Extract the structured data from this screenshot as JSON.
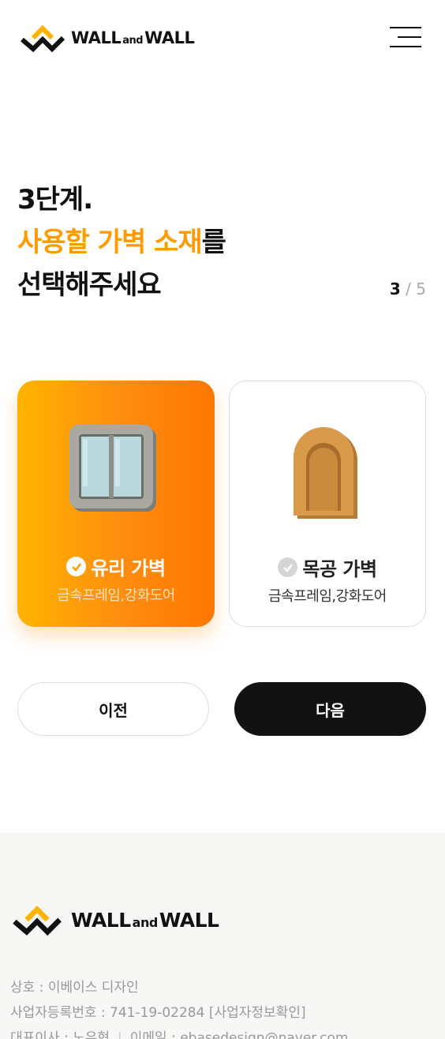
{
  "header": {
    "logo_text_left": "WALL",
    "logo_text_mid": "and",
    "logo_text_right": "WALL",
    "menu_icon": "hamburger-menu-icon"
  },
  "step": {
    "heading": "3단계.",
    "highlight": "사용할 가벽 소재",
    "heading_suffix": "를",
    "heading_line3": "선택해주세요",
    "current": "3",
    "separator": "/",
    "total": "5"
  },
  "options": [
    {
      "title": "유리 가벽",
      "subtitle": "금속프레임,강화도어",
      "selected": true,
      "icon": "glass-window-icon"
    },
    {
      "title": "목공 가벽",
      "subtitle": "금속프레임,강화도어",
      "selected": false,
      "icon": "wooden-arch-icon"
    }
  ],
  "nav": {
    "prev_label": "이전",
    "next_label": "다음"
  },
  "footer": {
    "logo_text_left": "WALL",
    "logo_text_mid": "and",
    "logo_text_right": "WALL",
    "company": "상호 : 이베이스 디자인",
    "business_no": "사업자등록번호 : 741-19-02284 [사업자정보확인]",
    "ceo": "대표이사 : 노유현",
    "email": "이메일 : ebasedesign@naver.com"
  },
  "colors": {
    "accent": "#ff9a00",
    "card_gradient_start": "#ffb300",
    "card_gradient_end": "#ff7700",
    "next_button": "#121212",
    "footer_bg": "#f7f7f5"
  }
}
